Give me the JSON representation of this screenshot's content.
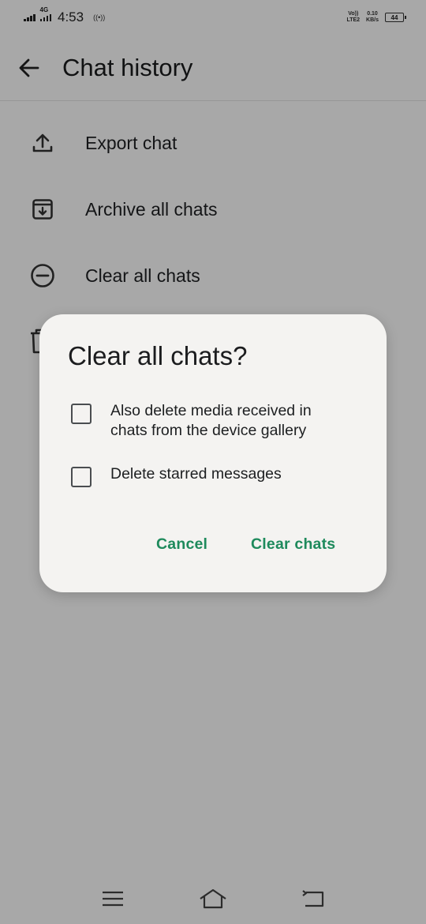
{
  "status_bar": {
    "network_type": "4G",
    "time": "4:53",
    "hotspot": "((•))",
    "volte_line1": "Vo))",
    "volte_line2": "LTE2",
    "speed_value": "0.10",
    "speed_unit": "KB/s",
    "battery": "44"
  },
  "app_bar": {
    "title": "Chat history",
    "back_icon": "arrow-back-icon"
  },
  "menu": [
    {
      "label": "Export chat",
      "icon": "upload-icon"
    },
    {
      "label": "Archive all chats",
      "icon": "archive-icon"
    },
    {
      "label": "Clear all chats",
      "icon": "minus-circle-icon"
    }
  ],
  "dialog": {
    "title": "Clear all chats?",
    "options": [
      {
        "label": "Also delete media received in chats from the device gallery",
        "checked": false
      },
      {
        "label": "Delete starred messages",
        "checked": false
      }
    ],
    "cancel_label": "Cancel",
    "confirm_label": "Clear chats"
  },
  "colors": {
    "accent": "#1e8a5c",
    "dialog_bg": "#f4f3f1",
    "scrim": "rgba(0,0,0,0.34)"
  }
}
